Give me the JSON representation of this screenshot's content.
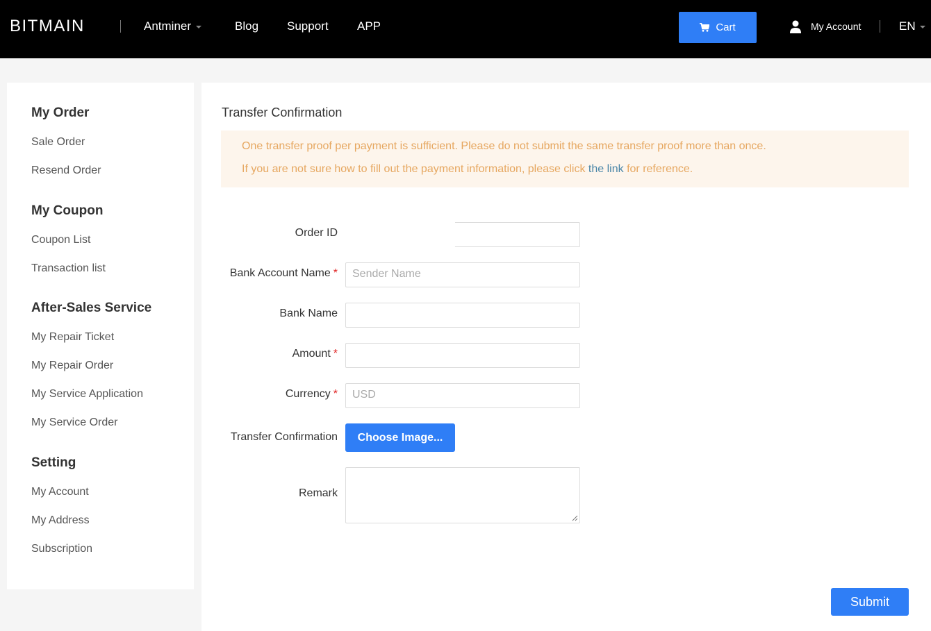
{
  "header": {
    "brand": "BITMAIN",
    "nav": [
      {
        "label": "Antminer"
      },
      {
        "label": "Blog"
      },
      {
        "label": "Support"
      },
      {
        "label": "APP"
      }
    ],
    "cart_label": "Cart",
    "account_label": "My Account",
    "language": "EN"
  },
  "sidebar": {
    "groups": [
      {
        "title": "My Order",
        "items": [
          "Sale Order",
          "Resend Order"
        ]
      },
      {
        "title": "My Coupon",
        "items": [
          "Coupon List",
          "Transaction list"
        ]
      },
      {
        "title": "After-Sales Service",
        "items": [
          "My Repair Ticket",
          "My Repair Order",
          "My Service Application",
          "My Service Order"
        ]
      },
      {
        "title": "Setting",
        "items": [
          "My Account",
          "My Address",
          "Subscription"
        ]
      }
    ]
  },
  "main": {
    "title": "Transfer Confirmation",
    "notice": {
      "line1": "One transfer proof per payment is sufficient. Please do not submit the same transfer proof more than once.",
      "line2_prefix": "If you are not sure how to fill out the payment information, please click ",
      "line2_link": "the link",
      "line2_suffix": " for reference."
    },
    "form": {
      "order_id_label": "Order ID",
      "bank_account_name_label": "Bank Account Name",
      "bank_account_name_placeholder": "Sender Name",
      "bank_name_label": "Bank Name",
      "amount_label": "Amount",
      "currency_label": "Currency",
      "currency_placeholder": "USD",
      "transfer_confirmation_label": "Transfer Confirmation",
      "choose_image_label": "Choose Image...",
      "remark_label": "Remark",
      "required_marker": "*"
    },
    "submit_label": "Submit"
  },
  "colors": {
    "header_bg": "#000000",
    "accent": "#2f7ef6",
    "notice_bg": "#fdf5ec",
    "notice_text": "#e6a760",
    "link": "#4a86a8",
    "required": "#e02020"
  },
  "icons": {
    "cart": "cart-icon",
    "user": "user-icon",
    "caret": "caret-down-icon"
  }
}
